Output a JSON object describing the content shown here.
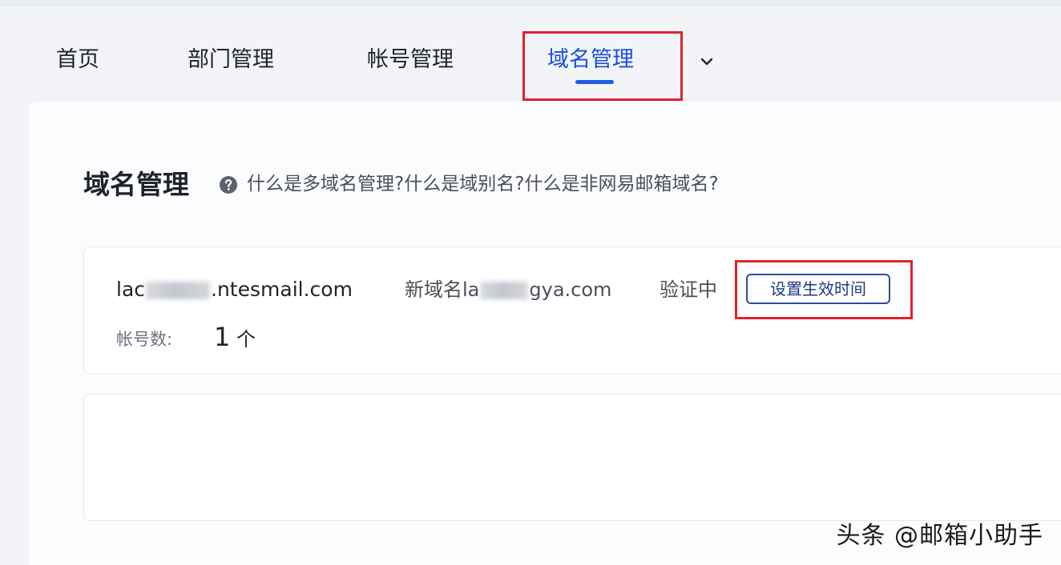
{
  "nav": {
    "tabs": [
      {
        "label": "首页"
      },
      {
        "label": "部门管理"
      },
      {
        "label": "帐号管理"
      },
      {
        "label": "域名管理"
      }
    ],
    "more_icon": "chevron-down-icon"
  },
  "page": {
    "title": "域名管理",
    "help_icon": "question-circle-icon",
    "help_links": [
      "什么是多域名管理?",
      "什么是域别名?",
      "什么是非网易邮箱域名?"
    ]
  },
  "domain_card": {
    "domain_prefix": "lac",
    "domain_suffix": ".ntesmail.com",
    "new_domain_prefix": "新域名la",
    "new_domain_suffix": "gya.com",
    "status": "验证中",
    "set_time_button": "设置生效时间",
    "account_label": "帐号数:",
    "account_count": "1",
    "account_unit": "个"
  },
  "watermark": "头条 @邮箱小助手",
  "colors": {
    "accent": "#1f5de6",
    "highlight": "#e0232e",
    "button_border": "#2c4e9a"
  }
}
